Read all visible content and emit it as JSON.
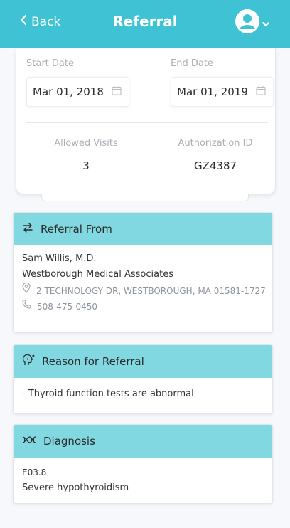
{
  "header": {
    "back_label": "Back",
    "title": "Referral",
    "bg_color": "#3fc3d4"
  },
  "dates": {
    "start_label": "Start Date",
    "start_value": "Mar 01, 2018",
    "end_label": "End Date",
    "end_value": "Mar 01, 2019",
    "allowed_visits_label": "Allowed Visits",
    "allowed_visits_value": "3",
    "authorization_label": "Authorization ID",
    "authorization_value": "GZ4387"
  },
  "referral_from": {
    "title": "Referral From",
    "doctor": "Sam Willis, M.D.",
    "practice": "Westborough Medical Associates",
    "address": "2 TECHNOLOGY DR, WESTBOROUGH, MA 01581-1727",
    "phone": "508-475-0450"
  },
  "reason": {
    "title": "Reason for Referral",
    "text": "- Thyroid function tests are abnormal"
  },
  "diagnosis": {
    "title": "Diagnosis",
    "code": "E03.8",
    "description": "Severe hypothyroidism"
  },
  "icons": {
    "back": "chevron-left-icon",
    "avatar": "user-avatar-icon",
    "dropdown": "chevron-down-icon",
    "calendar": "calendar-icon",
    "exchange": "exchange-arrows-icon",
    "location": "location-pin-icon",
    "phone": "phone-icon",
    "reason": "head-question-icon",
    "diagnosis": "dna-icon"
  },
  "colors": {
    "section_header": "#81d8e1",
    "background": "#f6f8fb"
  }
}
